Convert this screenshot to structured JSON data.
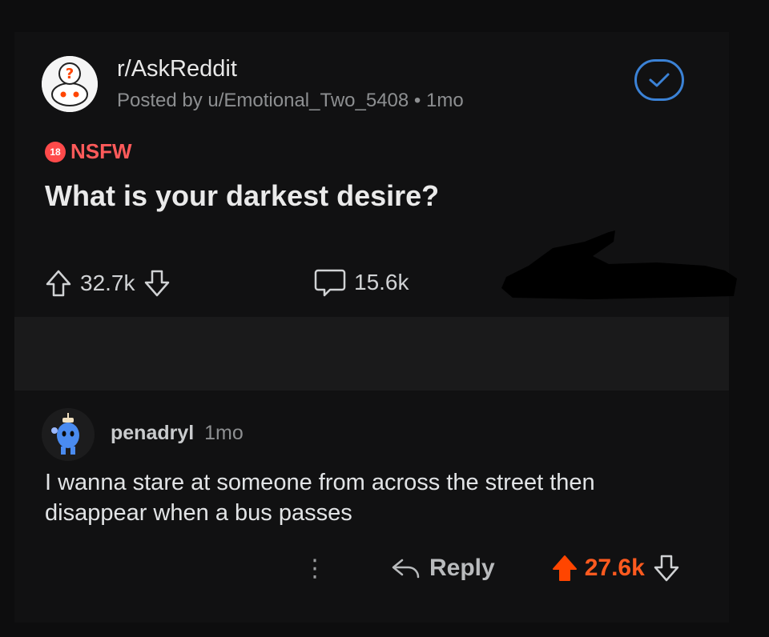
{
  "post": {
    "subreddit": "r/AskReddit",
    "posted_by": "Posted by u/Emotional_Two_5408 • 1mo",
    "nsfw_badge": "18",
    "nsfw_label": "NSFW",
    "title": "What is your darkest desire?",
    "upvotes": "32.7k",
    "comments": "15.6k"
  },
  "comment": {
    "author": "penadryl",
    "age": "1mo",
    "body": "I wanna stare at someone from across the street then disappear when a bus passes",
    "more": "⋮",
    "reply_label": "Reply",
    "votes": "27.6k"
  },
  "colors": {
    "background": "#0d0d0e",
    "nsfw": "#ff5a5a",
    "upvoted": "#ff5a1f",
    "check_blue": "#3b82d6"
  },
  "icons": [
    "subreddit-avatar",
    "check-circle-icon",
    "upvote-icon",
    "downvote-icon",
    "comment-icon",
    "more-icon",
    "reply-icon",
    "upvoted-icon"
  ]
}
